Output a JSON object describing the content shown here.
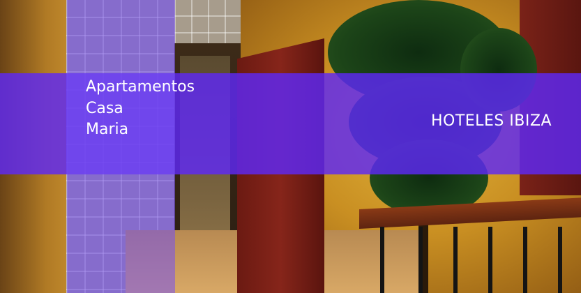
{
  "title_lines": [
    "Apartamentos",
    "Casa",
    "Maria"
  ],
  "brand": "HOTELES IBIZA",
  "colors": {
    "banner_overlay": "#5E28F5",
    "text": "#FFFFFF",
    "wall": "#D9A734"
  }
}
